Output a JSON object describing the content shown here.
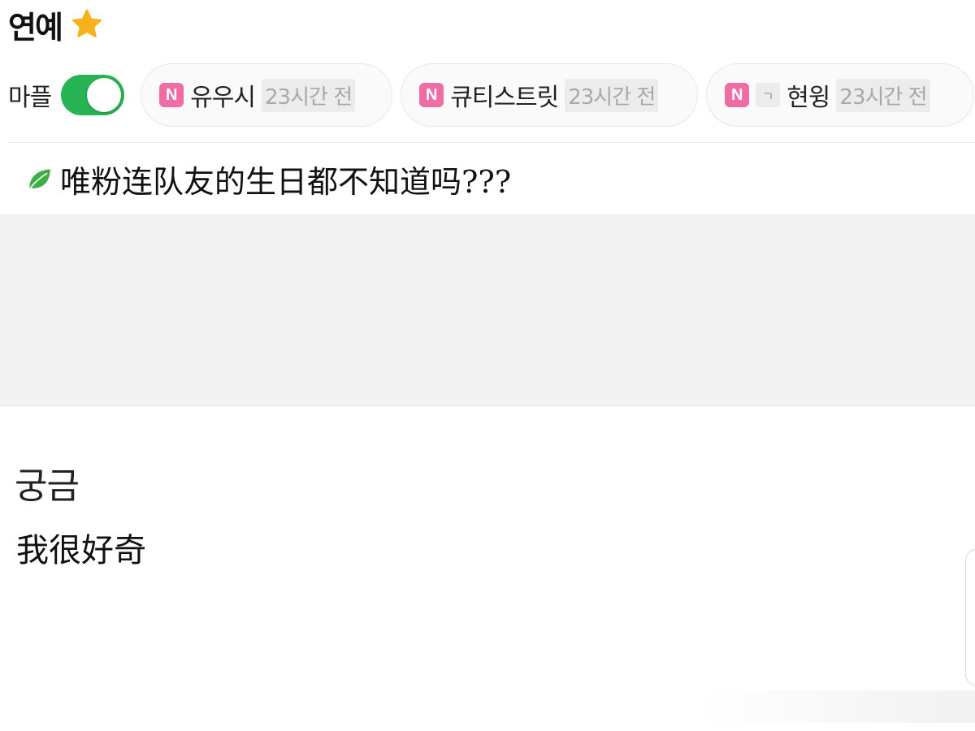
{
  "header": {
    "title": "연예",
    "star_icon": "star-icon",
    "star_color": "#f5b21a"
  },
  "filter": {
    "toggle_label": "마플",
    "toggle_on": true,
    "toggle_color": "#27b455",
    "pills": [
      {
        "badge": "N",
        "badge_color": "#f06ca5",
        "extra": "",
        "name": "유우시",
        "time": "23시간 전"
      },
      {
        "badge": "N",
        "badge_color": "#f06ca5",
        "extra": "",
        "name": "큐티스트릿",
        "time": "23시간 전"
      },
      {
        "badge": "N",
        "badge_color": "#f06ca5",
        "extra": "ㄱ",
        "name": "현윙",
        "time": "23시간 전"
      }
    ]
  },
  "post": {
    "icon": "leaf-icon",
    "title": "唯粉连队友的生日都不知道吗???",
    "body_korean": "궁금",
    "body_chinese": "我很好奇"
  }
}
